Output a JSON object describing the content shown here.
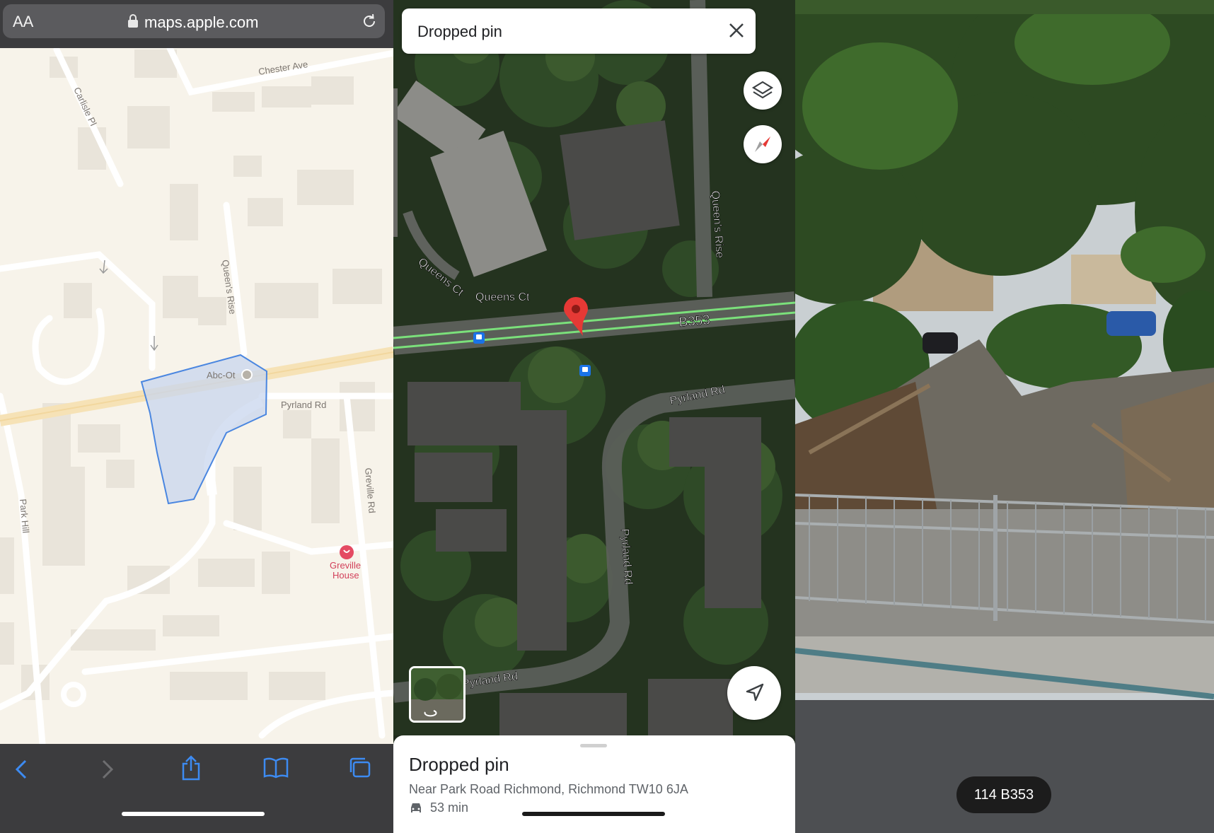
{
  "safari": {
    "text_size_label": "AA",
    "url": "maps.apple.com"
  },
  "apple_map": {
    "streets": {
      "chester": "Chester Ave",
      "carlisle": "Carlisle Pl",
      "queens_rise": "Queen's Rise",
      "pyrland": "Pyrland Rd",
      "greville": "Greville Rd",
      "park_hill": "Park Hill"
    },
    "poi_abc": "Abc-Ot",
    "poi_greville_1": "Greville",
    "poi_greville_2": "House"
  },
  "google_maps": {
    "search_title": "Dropped pin",
    "labels": {
      "queens_ct_a": "Queens Ct",
      "queens_ct_b": "Queens Ct",
      "queens_rise": "Queen's Rise",
      "road": "B353",
      "pyrland_a": "Pyrland Rd",
      "pyrland_b": "Pyrland Rd",
      "pyrland_c": "Pyrland Rd"
    },
    "sheet": {
      "title": "Dropped pin",
      "address": "Near Park Road Richmond, Richmond TW10 6JA",
      "duration": "53 min"
    }
  },
  "street_view": {
    "address_pill": "114 B353"
  },
  "colors": {
    "safari_chrome": "#3c3c3e",
    "safari_accent": "#3d8bf2",
    "route_green": "#7be07b",
    "pin_red": "#e53935"
  }
}
